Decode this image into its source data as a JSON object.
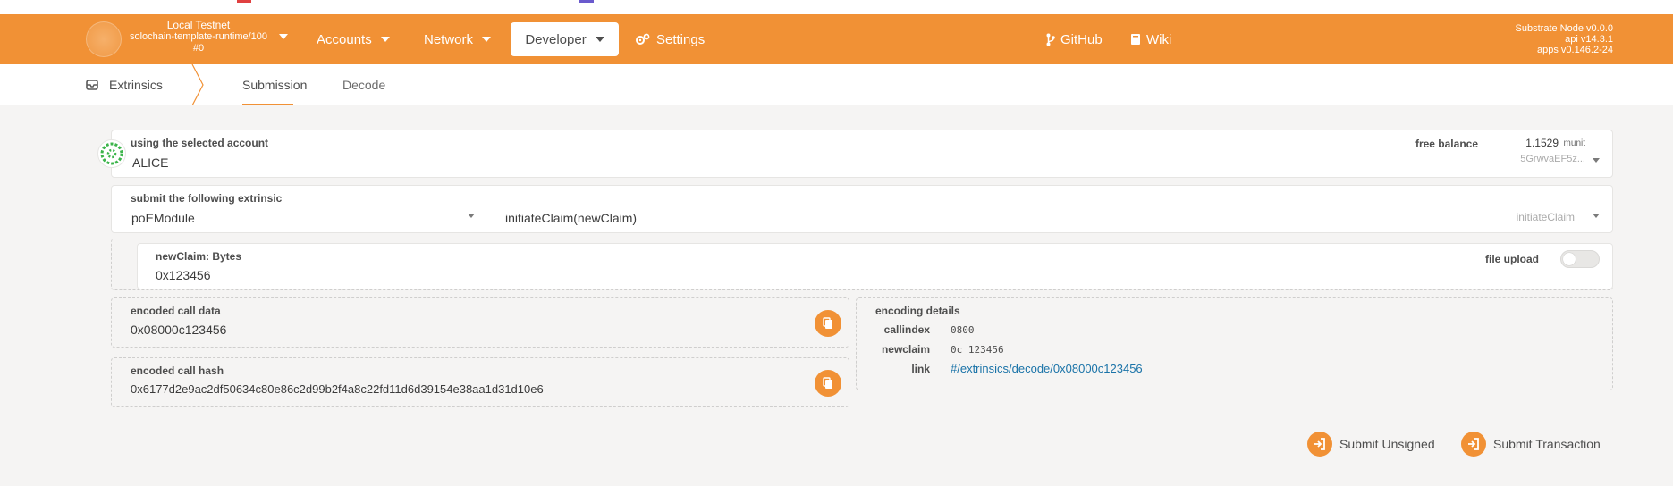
{
  "colors": {
    "accent": "#f19135",
    "link": "#1a73a8"
  },
  "header": {
    "chain_name": "Local Testnet",
    "runtime": "solochain-template-runtime/100",
    "block": "#0",
    "nav": {
      "accounts": "Accounts",
      "network": "Network",
      "developer": "Developer",
      "settings": "Settings",
      "github": "GitHub",
      "wiki": "Wiki"
    },
    "node_version": "Substrate Node v0.0.0",
    "api_version": "api v14.3.1",
    "apps_version": "apps v0.146.2-24"
  },
  "subnav": {
    "section": "Extrinsics",
    "tabs": [
      "Submission",
      "Decode"
    ],
    "active_tab": "Submission"
  },
  "account": {
    "label": "using the selected account",
    "name": "ALICE",
    "free_balance_label": "free balance",
    "free_balance_value": "1.1529",
    "free_balance_unit": "munit",
    "address": "5GrwvaEF5z..."
  },
  "extrinsic": {
    "label": "submit the following extrinsic",
    "module": "poEModule",
    "call": "initiateClaim(newClaim)",
    "call_selected": "initiateClaim"
  },
  "param": {
    "label": "newClaim: Bytes",
    "value": "0x123456",
    "file_upload_label": "file upload",
    "file_upload_on": false
  },
  "encoded_call_data": {
    "label": "encoded call data",
    "value": "0x08000c123456"
  },
  "encoded_call_hash": {
    "label": "encoded call hash",
    "value": "0x6177d2e9ac2df50634c80e86c2d99b2f4a8c22fd11d6d39154e38aa1d31d10e6"
  },
  "encoding_details": {
    "label": "encoding details",
    "callindex_key": "callindex",
    "callindex_value": "0800",
    "newclaim_key": "newclaim",
    "newclaim_value": "0c 123456",
    "link_key": "link",
    "link_value": "#/extrinsics/decode/0x08000c123456"
  },
  "actions": {
    "submit_unsigned": "Submit Unsigned",
    "submit_transaction": "Submit Transaction"
  }
}
